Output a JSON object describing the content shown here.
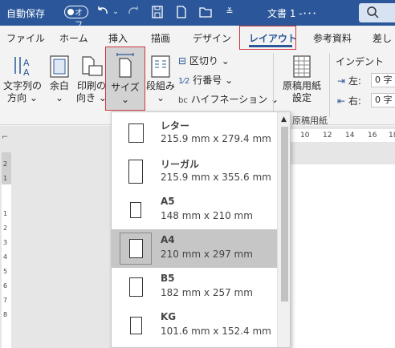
{
  "titlebar": {
    "autosave_label": "自動保存",
    "autosave_toggle": "オフ",
    "doc_name": "文書 1 -･･･",
    "icons": [
      "undo-icon",
      "redo-icon",
      "save-icon",
      "new-document-icon",
      "open-folder-icon",
      "customize-qat-icon",
      "search-icon"
    ]
  },
  "tabs": [
    {
      "label": "ファイル"
    },
    {
      "label": "ホーム"
    },
    {
      "label": "挿入"
    },
    {
      "label": "描画"
    },
    {
      "label": "デザイン"
    },
    {
      "label": "レイアウト",
      "active": true
    },
    {
      "label": "参考資料"
    },
    {
      "label": "差し"
    }
  ],
  "ribbon": {
    "text_direction": {
      "line1": "文字列の",
      "line2": "方向",
      "chevron": "⌄"
    },
    "margins": {
      "label": "余白",
      "chevron": "⌄"
    },
    "orientation": {
      "line1": "印刷の",
      "line2": "向き",
      "chevron": "⌄"
    },
    "size": {
      "label": "サイズ",
      "chevron": "⌄"
    },
    "columns": {
      "label": "段組み",
      "chevron": "⌄"
    },
    "breaks": {
      "label": "区切り",
      "chevron": "⌄"
    },
    "line_numbers": {
      "label": "行番号",
      "chevron": "⌄"
    },
    "hyphenation": {
      "label": "ハイフネーション",
      "chevron": "⌄"
    },
    "manuscript": {
      "line1": "原稿用紙",
      "line2": "設定",
      "group": "原稿用紙"
    },
    "indent": {
      "title": "インデント",
      "left_label": "左:",
      "left_value": "0 字",
      "right_label": "右:",
      "right_value": "0 字"
    }
  },
  "ruler": {
    "h_numbers": [
      "10",
      "12",
      "14",
      "16",
      "18"
    ],
    "v_numbers": [
      "2",
      "1",
      "1",
      "2",
      "3",
      "4",
      "5",
      "6",
      "7",
      "8"
    ]
  },
  "size_menu": {
    "items": [
      {
        "name": "レター",
        "dims": "215.9 mm x 279.4 mm",
        "ratio": 0.773
      },
      {
        "name": "リーガル",
        "dims": "215.9 mm x 355.6 mm",
        "ratio": 0.607
      },
      {
        "name": "A5",
        "dims": "148 mm x 210 mm",
        "ratio": 0.705
      },
      {
        "name": "A4",
        "dims": "210 mm x 297 mm",
        "ratio": 0.707,
        "selected": true
      },
      {
        "name": "B5",
        "dims": "182 mm x 257 mm",
        "ratio": 0.708
      },
      {
        "name": "KG",
        "dims": "101.6 mm x 152.4 mm",
        "ratio": 0.667
      }
    ]
  }
}
